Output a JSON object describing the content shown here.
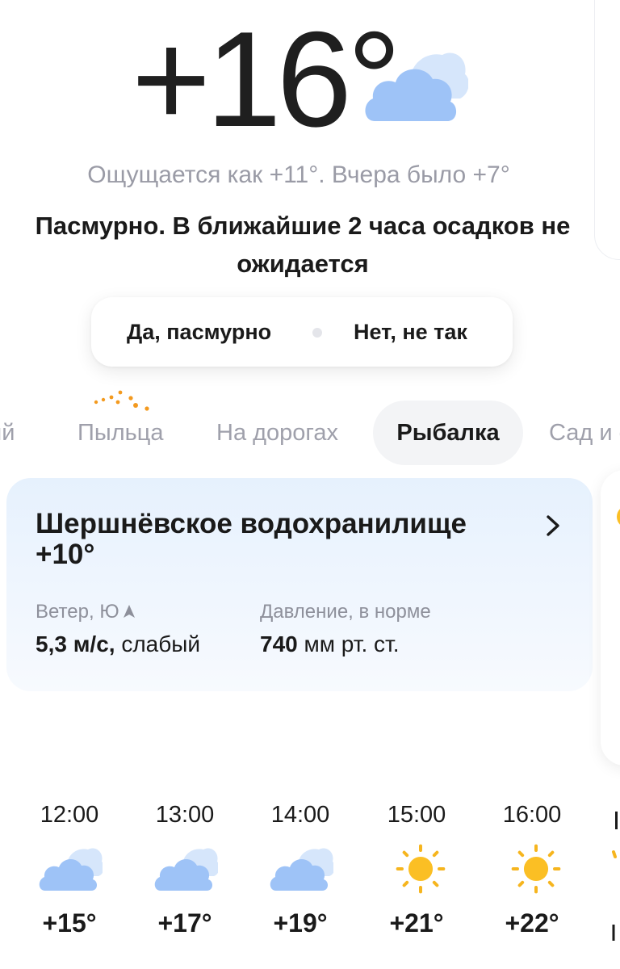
{
  "current": {
    "temperature": "+16°",
    "feels_like": "Ощущается как +11°. Вчера было +7°",
    "summary": "Пасмурно. В ближайшие 2 часа осадков не ожидается",
    "icon": "cloudy-icon"
  },
  "feedback": {
    "yes_label": "Да, пасмурно",
    "no_label": "Нет, не так"
  },
  "tabs": [
    {
      "label": "ий",
      "active": false
    },
    {
      "label": "Пыльца",
      "active": false,
      "icon": "pollen-dots-icon"
    },
    {
      "label": "На дорогах",
      "active": false
    },
    {
      "label": "Рыбалка",
      "active": true
    },
    {
      "label": "Сад и о",
      "active": false
    }
  ],
  "fishing": {
    "place": "Шершнёвское водохранилище",
    "water_temp": "+10°",
    "wind_label": "Ветер, Ю",
    "wind_speed": "5,3 м/с,",
    "wind_desc": "слабый",
    "pressure_label": "Давление, в норме",
    "pressure_value": "740",
    "pressure_unit": "мм рт. ст."
  },
  "hourly": [
    {
      "time": "12:00",
      "temp": "+15°",
      "icon": "cloudy-icon"
    },
    {
      "time": "13:00",
      "temp": "+17°",
      "icon": "cloudy-icon"
    },
    {
      "time": "14:00",
      "temp": "+19°",
      "icon": "cloudy-icon"
    },
    {
      "time": "15:00",
      "temp": "+21°",
      "icon": "sun-icon"
    },
    {
      "time": "16:00",
      "temp": "+22°",
      "icon": "sun-icon"
    }
  ],
  "colors": {
    "cloud_front": "#9ec3f7",
    "cloud_back": "#d6e6fb",
    "sun": "#fbbf24",
    "sun_rays": "#f6b51e",
    "pollen": "#f39a1f",
    "muted_text": "#9a9ba6"
  }
}
